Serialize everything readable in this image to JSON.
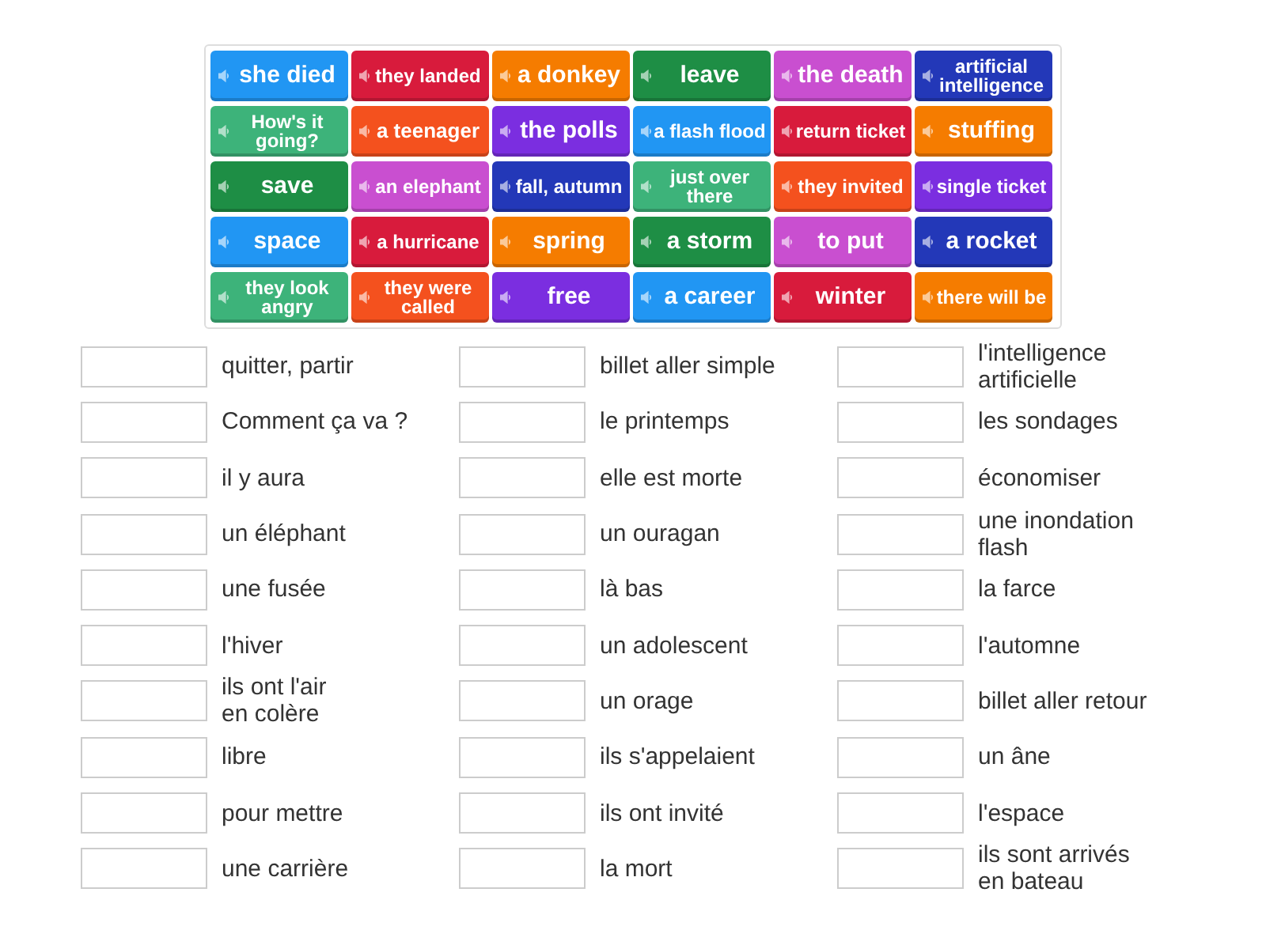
{
  "tiles": [
    {
      "text": "she died",
      "color": "#2196f3"
    },
    {
      "text": "they landed",
      "color": "#d81b3c"
    },
    {
      "text": "a donkey",
      "color": "#f57c00"
    },
    {
      "text": "leave",
      "color": "#1e8e45"
    },
    {
      "text": "the death",
      "color": "#c94fd0"
    },
    {
      "text": "artificial intelligence",
      "color": "#2338b8"
    },
    {
      "text": "How's it going?",
      "color": "#3db37a"
    },
    {
      "text": "a teenager",
      "color": "#f4511e"
    },
    {
      "text": "the polls",
      "color": "#7b2ee0"
    },
    {
      "text": "a flash flood",
      "color": "#2196f3"
    },
    {
      "text": "return ticket",
      "color": "#d81b3c"
    },
    {
      "text": "stuffing",
      "color": "#f57c00"
    },
    {
      "text": "save",
      "color": "#1e8e45"
    },
    {
      "text": "an elephant",
      "color": "#c94fd0"
    },
    {
      "text": "fall, autumn",
      "color": "#2338b8"
    },
    {
      "text": "just over there",
      "color": "#3db37a"
    },
    {
      "text": "they invited",
      "color": "#f4511e"
    },
    {
      "text": "single ticket",
      "color": "#7b2ee0"
    },
    {
      "text": "space",
      "color": "#2196f3"
    },
    {
      "text": "a hurricane",
      "color": "#d81b3c"
    },
    {
      "text": "spring",
      "color": "#f57c00"
    },
    {
      "text": "a storm",
      "color": "#1e8e45"
    },
    {
      "text": "to put",
      "color": "#c94fd0"
    },
    {
      "text": "a rocket",
      "color": "#2338b8"
    },
    {
      "text": "they look angry",
      "color": "#3db37a"
    },
    {
      "text": "they were called",
      "color": "#f4511e"
    },
    {
      "text": "free",
      "color": "#7b2ee0"
    },
    {
      "text": "a career",
      "color": "#2196f3"
    },
    {
      "text": "winter",
      "color": "#d81b3c"
    },
    {
      "text": "there will be",
      "color": "#f57c00"
    }
  ],
  "answers": [
    "quitter, partir",
    "billet aller simple",
    "l'intelligence\nartificielle",
    "Comment ça va ?",
    "le printemps",
    "les sondages",
    "il y aura",
    "elle est morte",
    "économiser",
    "un éléphant",
    "un ouragan",
    "une inondation\nflash",
    "une fusée",
    "là bas",
    "la farce",
    "l'hiver",
    "un adolescent",
    "l'automne",
    "ils ont l'air\nen colère",
    "un orage",
    "billet aller retour",
    "libre",
    "ils s'appelaient",
    "un âne",
    "pour mettre",
    "ils ont invité",
    "l'espace",
    "une carrière",
    "la mort",
    "ils sont arrivés\nen bateau"
  ]
}
